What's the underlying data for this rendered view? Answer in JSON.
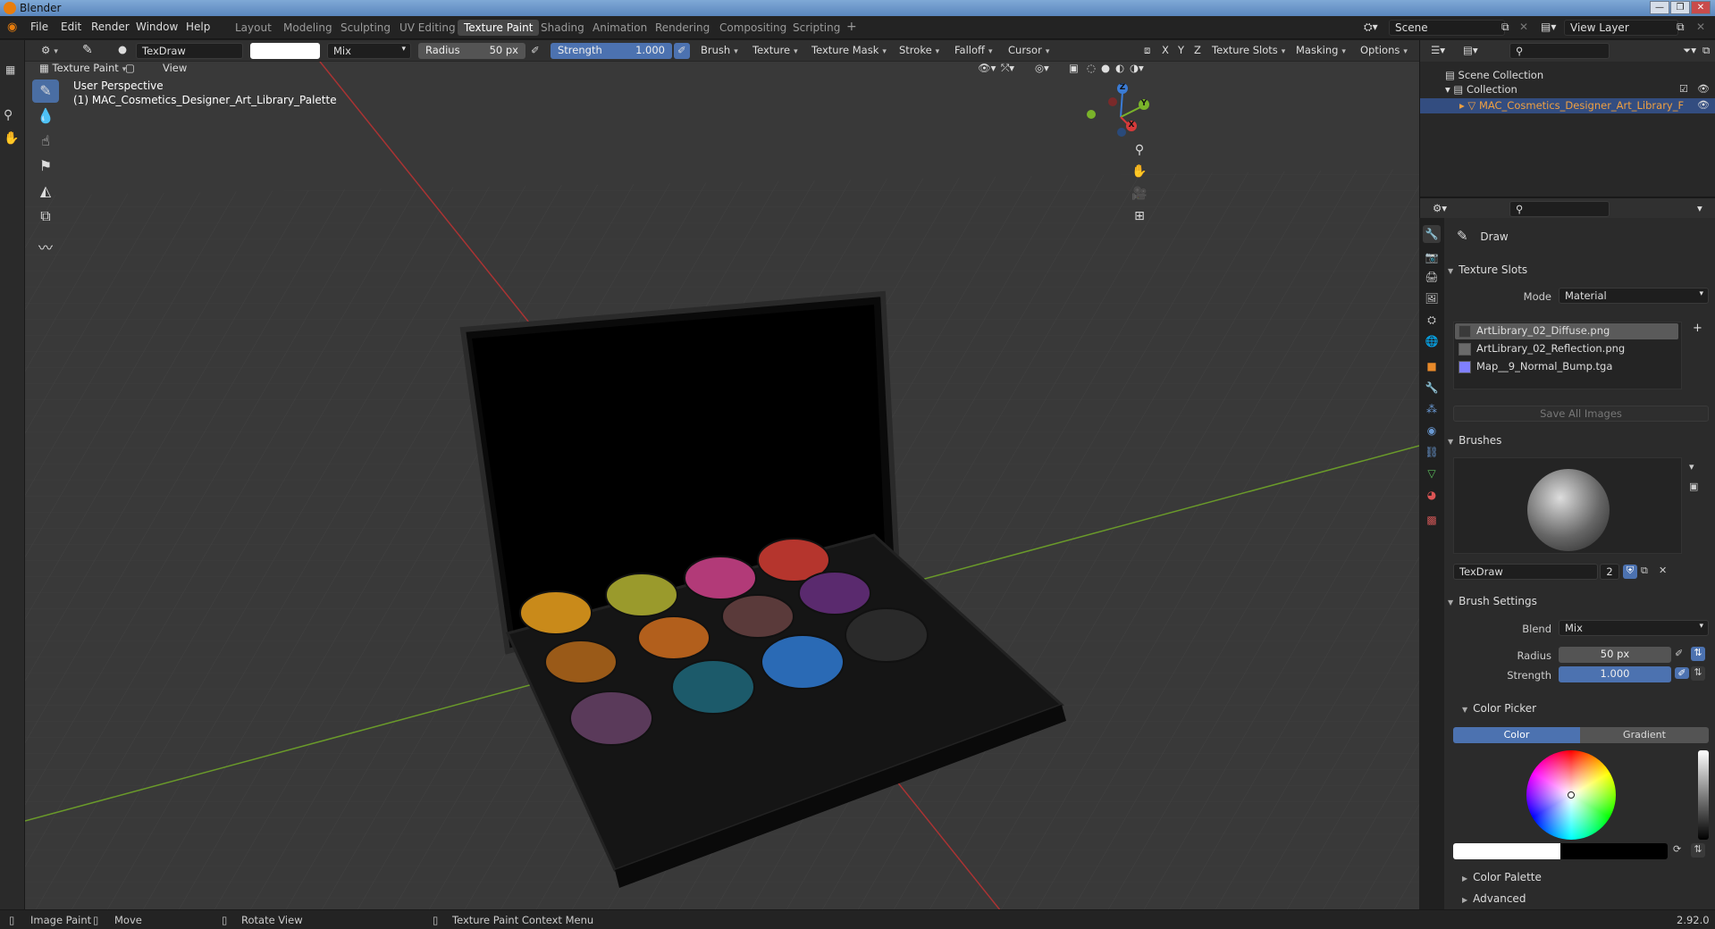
{
  "os": {
    "title": "Blender",
    "buttons": [
      "—",
      "❐",
      "✕"
    ]
  },
  "menu": {
    "items": [
      "File",
      "Edit",
      "Render",
      "Window",
      "Help"
    ]
  },
  "workspaces": [
    "Layout",
    "Modeling",
    "Sculpting",
    "UV Editing",
    "Texture Paint",
    "Shading",
    "Animation",
    "Rendering",
    "Compositing",
    "Scripting"
  ],
  "active_workspace": "Texture Paint",
  "add_workspace": "+",
  "scene": {
    "name": "Scene",
    "view_layer": "View Layer"
  },
  "toolheader": {
    "brush_name": "TexDraw",
    "blend": "Mix",
    "radius_label": "Radius",
    "radius_value": "50 px",
    "strength_label": "Strength",
    "strength_value": "1.000",
    "dropdowns": [
      "Brush",
      "Texture",
      "Texture Mask",
      "Stroke",
      "Falloff",
      "Cursor"
    ],
    "axes": [
      "X",
      "Y",
      "Z"
    ],
    "right_dropdowns": [
      "Texture Slots",
      "Masking",
      "Options"
    ]
  },
  "viewheader": {
    "mode": "Texture Paint",
    "view": "View"
  },
  "viewport": {
    "overlay_line1": "User Perspective",
    "overlay_line2": "(1) MAC_Cosmetics_Designer_Art_Library_Palette",
    "gizmo": {
      "z": "Z",
      "y": "Y",
      "x": "X"
    },
    "pans": [
      {
        "color": "#c98a1a"
      },
      {
        "color": "#9a9a2c"
      },
      {
        "color": "#b23a78"
      },
      {
        "color": "#b5352d"
      },
      {
        "color": "#9a5a18"
      },
      {
        "color": "#b25f1c"
      },
      {
        "color": "#5a3a3a"
      },
      {
        "color": "#5a2a6e"
      },
      {
        "color": "#5a3a5a"
      },
      {
        "color": "#1c5a6a"
      },
      {
        "color": "#2a6ab5"
      },
      {
        "color": "#2a2a2a"
      }
    ]
  },
  "outliner": {
    "search_placeholder": "",
    "scene_collection": "Scene Collection",
    "collection": "Collection",
    "object": "MAC_Cosmetics_Designer_Art_Library_F"
  },
  "properties": {
    "tool_name": "Draw",
    "texture_slots": {
      "title": "Texture Slots",
      "mode_label": "Mode",
      "mode_value": "Material",
      "items": [
        {
          "name": "ArtLibrary_02_Diffuse.png",
          "swatch": "#3a3a3a"
        },
        {
          "name": "ArtLibrary_02_Reflection.png",
          "swatch": "#6a6a6a"
        },
        {
          "name": "Map__9_Normal_Bump.tga",
          "swatch": "#8080ff"
        }
      ],
      "save_all": "Save All Images"
    },
    "brushes": {
      "title": "Brushes",
      "brush_name": "TexDraw",
      "users": "2"
    },
    "brush_settings": {
      "title": "Brush Settings",
      "blend_label": "Blend",
      "blend_value": "Mix",
      "radius_label": "Radius",
      "radius_value": "50 px",
      "strength_label": "Strength",
      "strength_value": "1.000"
    },
    "color_picker": {
      "title": "Color Picker",
      "tab_color": "Color",
      "tab_gradient": "Gradient"
    },
    "color_palette": "Color Palette",
    "advanced": "Advanced"
  },
  "statusbar": {
    "image_paint": "Image Paint",
    "move": "Move",
    "rotate": "Rotate View",
    "context": "Texture Paint Context Menu",
    "version": "2.92.0"
  },
  "colors": {
    "accent": "#4a6ea3",
    "slider": "#4c72b0",
    "header": "#303030",
    "viewport": "#393939"
  }
}
